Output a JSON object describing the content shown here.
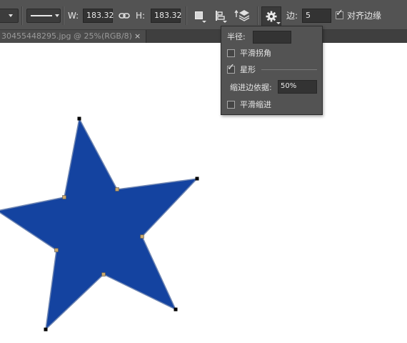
{
  "options_bar": {
    "w_label": "W:",
    "w_value": "183.32",
    "h_label": "H:",
    "h_value": "183.32",
    "sides_label": "边:",
    "sides_value": "5",
    "align_edges_label": "对齐边缘",
    "align_edges_checked": true
  },
  "document_tab": {
    "title": "30455448295.jpg @ 25%(RGB/8)",
    "close": "×"
  },
  "polygon_options": {
    "radius_label": "半径:",
    "radius_value": "",
    "smooth_corners_label": "平滑拐角",
    "smooth_corners_checked": false,
    "star_label": "星形",
    "star_checked": true,
    "indent_label": "缩进边依据:",
    "indent_value": "50%",
    "smooth_indents_label": "平滑缩进",
    "smooth_indents_checked": false
  },
  "shape": {
    "type": "five-point star",
    "fill": "#1443a0",
    "stroke": "#6f86b3"
  },
  "colors": {
    "toolbar_bg": "#535353",
    "field_bg": "#333333",
    "canvas_bg": "#ffffff"
  }
}
